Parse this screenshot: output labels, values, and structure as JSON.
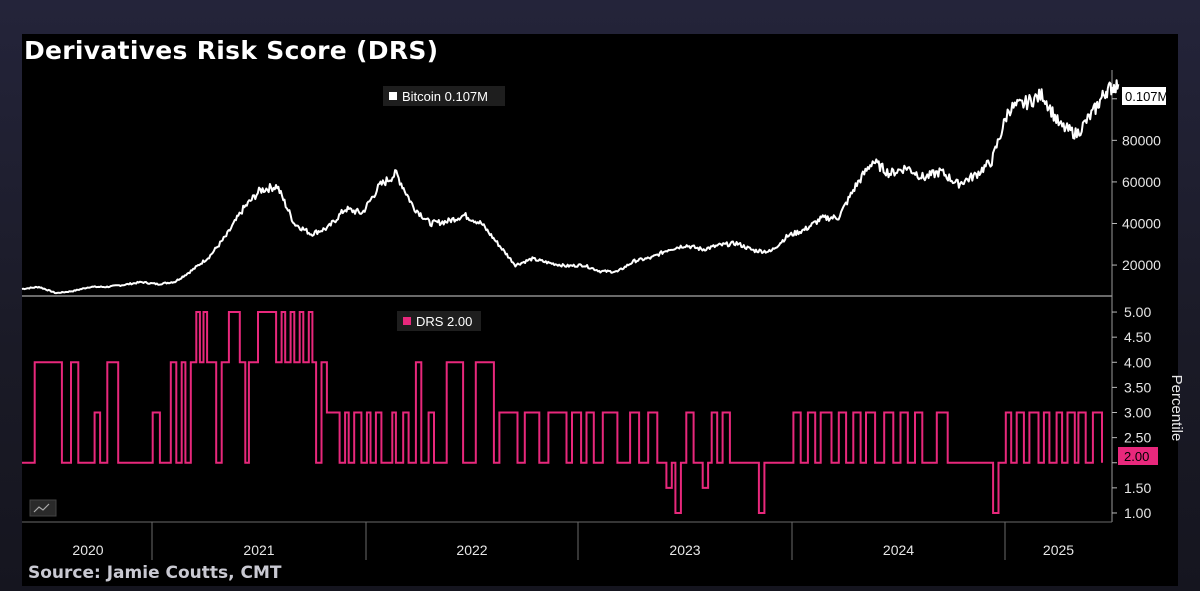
{
  "title": "Derivatives Risk Score (DRS)",
  "source": "Source: Jamie Coutts, CMT",
  "colors": {
    "price": "#ffffff",
    "drs": "#e8287c",
    "background": "#000000"
  },
  "chart_data": [
    {
      "type": "line",
      "series": [
        {
          "name": "Bitcoin",
          "color": "#ffffff"
        }
      ],
      "legend": "Bitcoin 0.107M",
      "last_value_label": "0.107M",
      "y_ticks": [
        {
          "value": 20000,
          "label": "20000"
        },
        {
          "value": 40000,
          "label": "40000"
        },
        {
          "value": 60000,
          "label": "60000"
        },
        {
          "value": 80000,
          "label": "80000"
        },
        {
          "value": 100000,
          "label": "0.1M"
        }
      ],
      "ylim": [
        8000,
        110000
      ],
      "x": [
        "2020-01",
        "2020-02",
        "2020-03",
        "2020-04",
        "2020-05",
        "2020-06",
        "2020-07",
        "2020-08",
        "2020-09",
        "2020-10",
        "2020-11",
        "2020-12",
        "2021-01",
        "2021-02",
        "2021-03",
        "2021-04",
        "2021-05",
        "2021-06",
        "2021-07",
        "2021-08",
        "2021-09",
        "2021-10",
        "2021-11",
        "2021-12",
        "2022-01",
        "2022-02",
        "2022-03",
        "2022-04",
        "2022-05",
        "2022-06",
        "2022-07",
        "2022-08",
        "2022-09",
        "2022-10",
        "2022-11",
        "2022-12",
        "2023-01",
        "2023-02",
        "2023-03",
        "2023-04",
        "2023-05",
        "2023-06",
        "2023-07",
        "2023-08",
        "2023-09",
        "2023-10",
        "2023-11",
        "2023-12",
        "2024-01",
        "2024-02",
        "2024-03",
        "2024-04",
        "2024-05",
        "2024-06",
        "2024-07",
        "2024-08",
        "2024-09",
        "2024-10",
        "2024-11",
        "2024-12",
        "2025-01",
        "2025-02",
        "2025-03",
        "2025-04"
      ],
      "values": [
        8500,
        9500,
        6500,
        7500,
        9500,
        9500,
        10500,
        11800,
        10800,
        12000,
        17500,
        24000,
        34000,
        47000,
        56000,
        58000,
        40000,
        35000,
        38000,
        47000,
        45000,
        58000,
        64000,
        48000,
        40000,
        41000,
        44000,
        40000,
        30000,
        20000,
        23000,
        21000,
        19500,
        20000,
        17000,
        16800,
        22000,
        23500,
        27500,
        29500,
        27500,
        29500,
        30500,
        27000,
        26500,
        34000,
        37000,
        42500,
        43000,
        58000,
        70000,
        64000,
        67000,
        62000,
        65000,
        59000,
        63000,
        70000,
        95000,
        98000,
        102000,
        87000,
        83000,
        94000,
        104000,
        107000
      ]
    },
    {
      "type": "line",
      "series": [
        {
          "name": "DRS",
          "color": "#e8287c"
        }
      ],
      "legend": "DRS 2.00",
      "last_value_label": "2.00",
      "ylabel": "Percentile",
      "y_ticks": [
        {
          "value": 1.0,
          "label": "1.00"
        },
        {
          "value": 1.5,
          "label": "1.50"
        },
        {
          "value": 2.0,
          "label": "2.00"
        },
        {
          "value": 2.5,
          "label": "2.50"
        },
        {
          "value": 3.0,
          "label": "3.00"
        },
        {
          "value": 3.5,
          "label": "3.50"
        },
        {
          "value": 4.0,
          "label": "4.00"
        },
        {
          "value": 4.5,
          "label": "4.50"
        },
        {
          "value": 5.0,
          "label": "5.00"
        }
      ],
      "ylim": [
        0.9,
        5.2
      ],
      "steps": [
        [
          2020.0,
          2
        ],
        [
          2020.07,
          4
        ],
        [
          2020.22,
          2
        ],
        [
          2020.27,
          4
        ],
        [
          2020.31,
          2
        ],
        [
          2020.4,
          3
        ],
        [
          2020.43,
          2
        ],
        [
          2020.47,
          4
        ],
        [
          2020.53,
          2
        ],
        [
          2020.68,
          2
        ],
        [
          2020.72,
          3
        ],
        [
          2020.76,
          2
        ],
        [
          2020.8,
          2
        ],
        [
          2020.82,
          4
        ],
        [
          2020.85,
          2
        ],
        [
          2020.88,
          4
        ],
        [
          2020.9,
          2
        ],
        [
          2020.93,
          4
        ],
        [
          2020.96,
          5
        ],
        [
          2020.98,
          4
        ],
        [
          2021.0,
          5
        ],
        [
          2021.02,
          4
        ],
        [
          2021.07,
          2
        ],
        [
          2021.1,
          4
        ],
        [
          2021.14,
          5
        ],
        [
          2021.2,
          4
        ],
        [
          2021.23,
          2
        ],
        [
          2021.25,
          4
        ],
        [
          2021.3,
          5
        ],
        [
          2021.4,
          4
        ],
        [
          2021.43,
          5
        ],
        [
          2021.45,
          4
        ],
        [
          2021.48,
          5
        ],
        [
          2021.5,
          4
        ],
        [
          2021.53,
          5
        ],
        [
          2021.55,
          4
        ],
        [
          2021.58,
          5
        ],
        [
          2021.6,
          4
        ],
        [
          2021.62,
          2
        ],
        [
          2021.65,
          4
        ],
        [
          2021.68,
          3
        ],
        [
          2021.75,
          2
        ],
        [
          2021.78,
          3
        ],
        [
          2021.8,
          2
        ],
        [
          2021.83,
          3
        ],
        [
          2021.87,
          2
        ],
        [
          2021.9,
          3
        ],
        [
          2021.92,
          2
        ],
        [
          2021.95,
          3
        ],
        [
          2021.98,
          2
        ],
        [
          2022.0,
          2
        ],
        [
          2022.04,
          3
        ],
        [
          2022.06,
          2
        ],
        [
          2022.1,
          3
        ],
        [
          2022.13,
          2
        ],
        [
          2022.17,
          4
        ],
        [
          2022.2,
          2
        ],
        [
          2022.24,
          3
        ],
        [
          2022.27,
          2
        ],
        [
          2022.3,
          2
        ],
        [
          2022.34,
          4
        ],
        [
          2022.43,
          2
        ],
        [
          2022.46,
          2
        ],
        [
          2022.5,
          4
        ],
        [
          2022.6,
          2
        ],
        [
          2022.63,
          3
        ],
        [
          2022.73,
          2
        ],
        [
          2022.77,
          3
        ],
        [
          2022.85,
          2
        ],
        [
          2022.9,
          3
        ],
        [
          2023.0,
          2
        ],
        [
          2023.03,
          3
        ],
        [
          2023.08,
          2
        ],
        [
          2023.11,
          3
        ],
        [
          2023.15,
          2
        ],
        [
          2023.2,
          3
        ],
        [
          2023.28,
          2
        ],
        [
          2023.33,
          2
        ],
        [
          2023.35,
          3
        ],
        [
          2023.4,
          2
        ],
        [
          2023.45,
          3
        ],
        [
          2023.5,
          2
        ],
        [
          2023.55,
          1.5
        ],
        [
          2023.58,
          2
        ],
        [
          2023.6,
          1
        ],
        [
          2023.63,
          2
        ],
        [
          2023.66,
          3
        ],
        [
          2023.7,
          2
        ],
        [
          2023.75,
          1.5
        ],
        [
          2023.78,
          2
        ],
        [
          2023.8,
          3
        ],
        [
          2023.83,
          2
        ],
        [
          2023.86,
          3
        ],
        [
          2023.9,
          2
        ],
        [
          2023.93,
          2
        ],
        [
          2024.0,
          2
        ],
        [
          2024.06,
          1
        ],
        [
          2024.09,
          2
        ],
        [
          2024.2,
          2
        ],
        [
          2024.25,
          3
        ],
        [
          2024.29,
          2
        ],
        [
          2024.33,
          3
        ],
        [
          2024.37,
          2
        ],
        [
          2024.4,
          3
        ],
        [
          2024.46,
          2
        ],
        [
          2024.5,
          3
        ],
        [
          2024.54,
          2
        ],
        [
          2024.58,
          3
        ],
        [
          2024.62,
          2
        ],
        [
          2024.65,
          3
        ],
        [
          2024.7,
          2
        ],
        [
          2024.75,
          3
        ],
        [
          2024.8,
          2
        ],
        [
          2024.84,
          3
        ],
        [
          2024.88,
          2
        ],
        [
          2024.92,
          3
        ],
        [
          2024.96,
          2
        ],
        [
          2025.0,
          2
        ],
        [
          2025.04,
          3
        ],
        [
          2025.1,
          2
        ],
        [
          2025.3,
          2
        ],
        [
          2025.35,
          1
        ],
        [
          2025.38,
          2
        ],
        [
          2025.42,
          3
        ],
        [
          2025.45,
          2
        ],
        [
          2025.48,
          3
        ],
        [
          2025.52,
          2
        ],
        [
          2025.55,
          3
        ],
        [
          2025.6,
          2
        ],
        [
          2025.63,
          3
        ],
        [
          2025.66,
          2
        ],
        [
          2025.7,
          3
        ],
        [
          2025.73,
          2
        ],
        [
          2025.76,
          3
        ],
        [
          2025.8,
          2
        ],
        [
          2025.82,
          3
        ],
        [
          2025.86,
          2
        ],
        [
          2025.9,
          3
        ],
        [
          2025.95,
          2
        ]
      ]
    }
  ],
  "x_axis": {
    "years": [
      "2020",
      "2021",
      "2022",
      "2023",
      "2024",
      "2025"
    ]
  }
}
